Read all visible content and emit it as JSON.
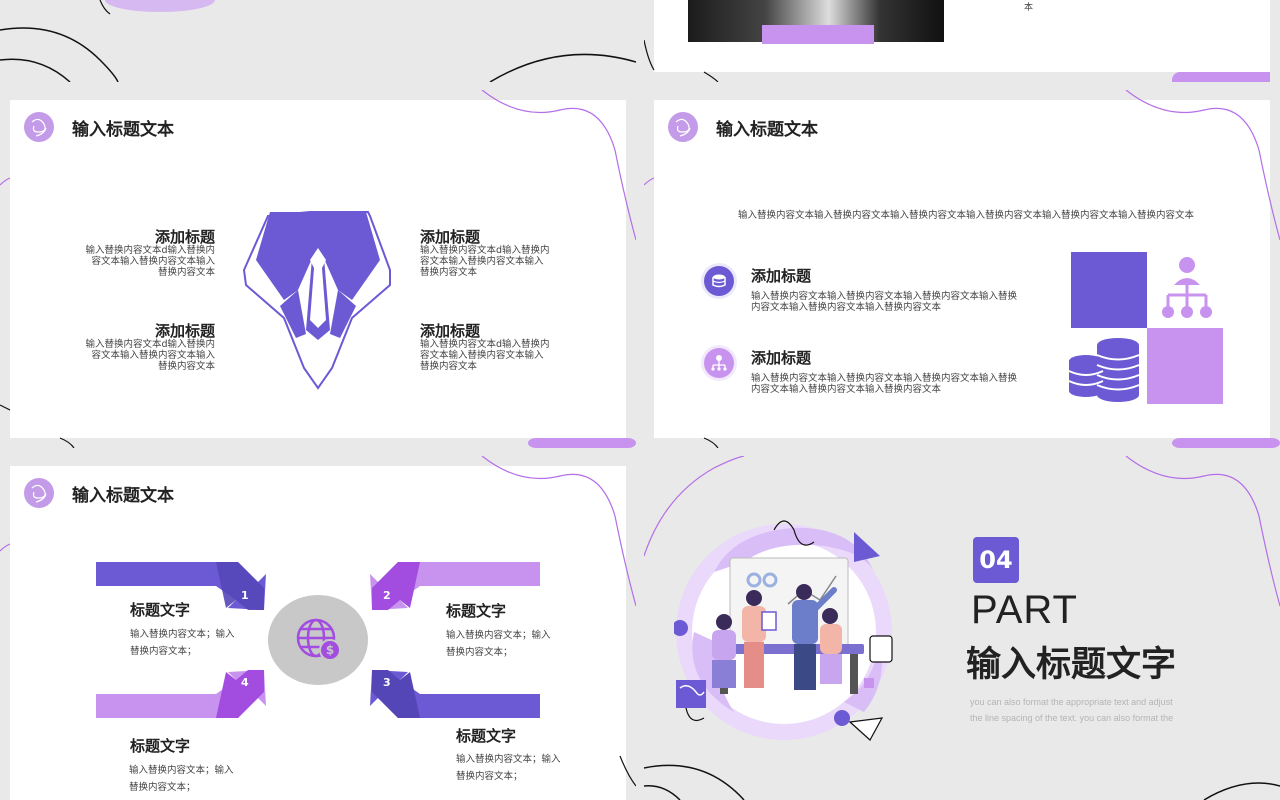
{
  "colors": {
    "accent_dark": "#6c5ad4",
    "accent_light": "#c893ee",
    "accent_mid": "#a24ce0",
    "background": "#e9e9e9",
    "card": "#ffffff",
    "circle_gray": "#c8c8c8"
  },
  "top_right": {
    "fragment": "本"
  },
  "slide_suit": {
    "title": "输入标题文本",
    "blocks": [
      {
        "heading": "添加标题",
        "body": [
          "输入替换内容文本d输入替换内",
          "容文本输入替换内容文本输入",
          "替换内容文本"
        ]
      },
      {
        "heading": "添加标题",
        "body": [
          "输入替换内容文本d输入替换内",
          "容文本输入替换内容文本输入",
          "替换内容文本"
        ]
      },
      {
        "heading": "添加标题",
        "body": [
          "输入替换内容文本d输入替换内",
          "容文本输入替换内容文本输入",
          "替换内容文本"
        ]
      },
      {
        "heading": "添加标题",
        "body": [
          "输入替换内容文本d输入替换内",
          "容文本输入替换内容文本输入",
          "替换内容文本"
        ]
      }
    ]
  },
  "slide_finance": {
    "title": "输入标题文本",
    "intro": "输入替换内容文本输入替换内容文本输入替换内容文本输入替换内容文本输入替换内容文本输入替换内容文本",
    "items": [
      {
        "icon": "database-icon",
        "heading": "添加标题",
        "body": [
          "输入替换内容文本输入替换内容文本输入替换内容文本输入替换",
          "内容文本输入替换内容文本输入替换内容文本"
        ]
      },
      {
        "icon": "org-chart-icon",
        "heading": "添加标题",
        "body": [
          "输入替换内容文本输入替换内容文本输入替换内容文本输入替换",
          "内容文本输入替换内容文本输入替换内容文本"
        ]
      }
    ]
  },
  "slide_arrows": {
    "title": "输入标题文本",
    "center_icon": "globe-dollar-icon",
    "items": [
      {
        "num": "1",
        "heading": "标题文字",
        "body": [
          "输入替换内容文本；输入",
          "替换内容文本；"
        ]
      },
      {
        "num": "2",
        "heading": "标题文字",
        "body": [
          "输入替换内容文本；输入",
          "替换内容文本；"
        ]
      },
      {
        "num": "3",
        "heading": "标题文字",
        "body": [
          "输入替换内容文本；输入",
          "替换内容文本；"
        ]
      },
      {
        "num": "4",
        "heading": "标题文字",
        "body": [
          "输入替换内容文本；输入",
          "替换内容文本；"
        ]
      }
    ]
  },
  "slide_part": {
    "number": "04",
    "part": "PART",
    "title": "输入标题文字",
    "sub": [
      "you can also format the appropriate text and adjust",
      "the line spacing of the text. you can also format the"
    ]
  }
}
